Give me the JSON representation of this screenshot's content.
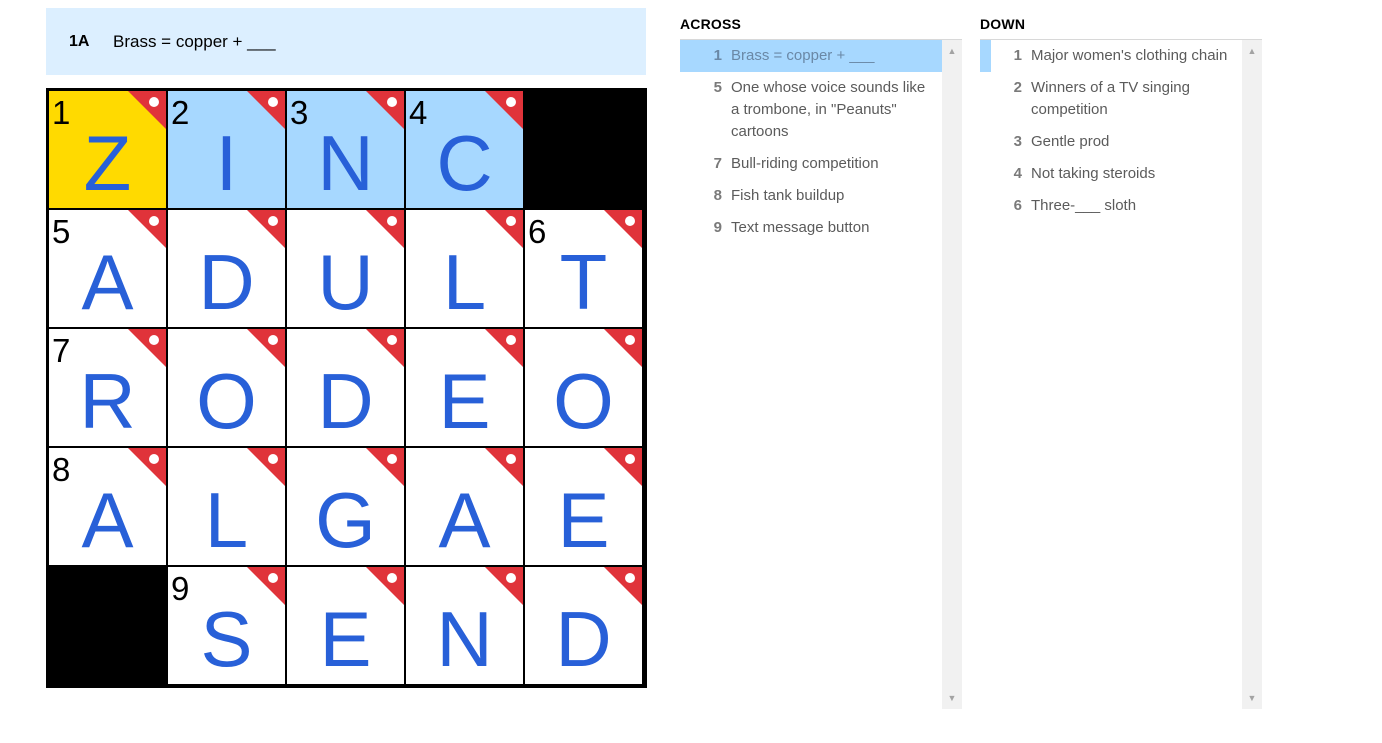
{
  "clue_bar": {
    "number": "1A",
    "text": "Brass = copper + ___"
  },
  "grid": {
    "rows": [
      [
        {
          "n": "1",
          "l": "Z",
          "state": "active"
        },
        {
          "n": "2",
          "l": "I",
          "state": "word"
        },
        {
          "n": "3",
          "l": "N",
          "state": "word"
        },
        {
          "n": "4",
          "l": "C",
          "state": "word"
        },
        {
          "black": true
        }
      ],
      [
        {
          "n": "5",
          "l": "A"
        },
        {
          "n": "",
          "l": "D"
        },
        {
          "n": "",
          "l": "U"
        },
        {
          "n": "",
          "l": "L"
        },
        {
          "n": "6",
          "l": "T"
        }
      ],
      [
        {
          "n": "7",
          "l": "R"
        },
        {
          "n": "",
          "l": "O"
        },
        {
          "n": "",
          "l": "D"
        },
        {
          "n": "",
          "l": "E"
        },
        {
          "n": "",
          "l": "O"
        }
      ],
      [
        {
          "n": "8",
          "l": "A"
        },
        {
          "n": "",
          "l": "L"
        },
        {
          "n": "",
          "l": "G"
        },
        {
          "n": "",
          "l": "A"
        },
        {
          "n": "",
          "l": "E"
        }
      ],
      [
        {
          "black": true
        },
        {
          "n": "9",
          "l": "S"
        },
        {
          "n": "",
          "l": "E"
        },
        {
          "n": "",
          "l": "N"
        },
        {
          "n": "",
          "l": "D"
        }
      ]
    ],
    "colors": {
      "letter": "#2860d8",
      "flag": "#e0333a",
      "word": "#a7d8ff",
      "active": "#ffda00"
    }
  },
  "across": {
    "title": "ACROSS",
    "clues": [
      {
        "n": "1",
        "t": "Brass = copper + ___",
        "selected": true
      },
      {
        "n": "5",
        "t": "One whose voice sounds like a trombone, in \"Peanuts\" cartoons"
      },
      {
        "n": "7",
        "t": "Bull-riding competition"
      },
      {
        "n": "8",
        "t": "Fish tank buildup"
      },
      {
        "n": "9",
        "t": "Text message button"
      }
    ]
  },
  "down": {
    "title": "DOWN",
    "clues": [
      {
        "n": "1",
        "t": "Major women's clothing chain",
        "marked": true
      },
      {
        "n": "2",
        "t": "Winners of a TV singing competition"
      },
      {
        "n": "3",
        "t": "Gentle prod"
      },
      {
        "n": "4",
        "t": "Not taking steroids"
      },
      {
        "n": "6",
        "t": "Three-___ sloth"
      }
    ]
  },
  "scroll_icons": {
    "up": "▲",
    "down": "▼"
  }
}
